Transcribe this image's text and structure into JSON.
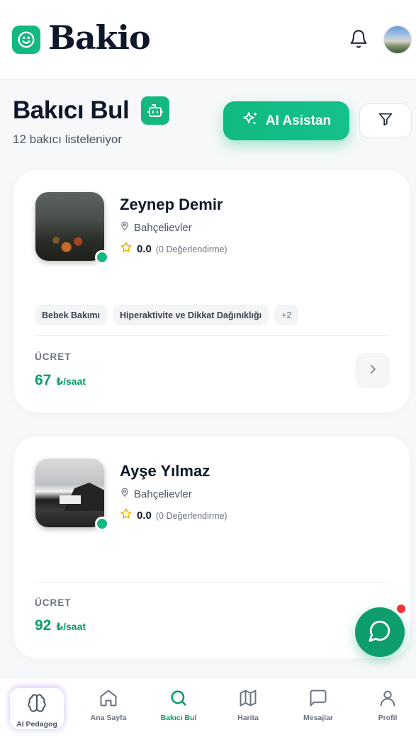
{
  "header": {
    "brand": "Bakio",
    "notifications_icon": "bell-icon",
    "avatar_icon": "user-avatar"
  },
  "page": {
    "title": "Bakıcı Bul",
    "subtitle": "12 bakıcı listeleniyor",
    "ai_button_label": "AI Asistan",
    "filter_icon": "filter-icon"
  },
  "caregivers": [
    {
      "name": "Zeynep Demir",
      "location": "Bahçelievler",
      "rating": "0.0",
      "rating_count": "(0 Değerlendirme)",
      "tags": [
        "Bebek Bakımı",
        "Hiperaktivite ve Dikkat Dağınıklığı",
        "+2"
      ],
      "fee_label": "ÜCRET",
      "fee": "67",
      "fee_unit": "₺/saat",
      "online": true
    },
    {
      "name": "Ayşe Yılmaz",
      "location": "Bahçelievler",
      "rating": "0.0",
      "rating_count": "(0 Değerlendirme)",
      "tags": [],
      "fee_label": "ÜCRET",
      "fee": "92",
      "fee_unit": "₺/saat",
      "online": true
    }
  ],
  "bottom_nav": [
    {
      "label": "AI Pedagog",
      "icon": "brain-icon",
      "active": false
    },
    {
      "label": "Ana Sayfa",
      "icon": "home-icon",
      "active": false
    },
    {
      "label": "Bakıcı Bul",
      "icon": "search-icon",
      "active": true
    },
    {
      "label": "Harita",
      "icon": "map-icon",
      "active": false
    },
    {
      "label": "Mesajlar",
      "icon": "message-icon",
      "active": false
    },
    {
      "label": "Profil",
      "icon": "user-icon",
      "active": false
    }
  ],
  "colors": {
    "accent": "#12b981",
    "fee_text": "#0f9a6c",
    "notification_dot": "#ef3535"
  }
}
